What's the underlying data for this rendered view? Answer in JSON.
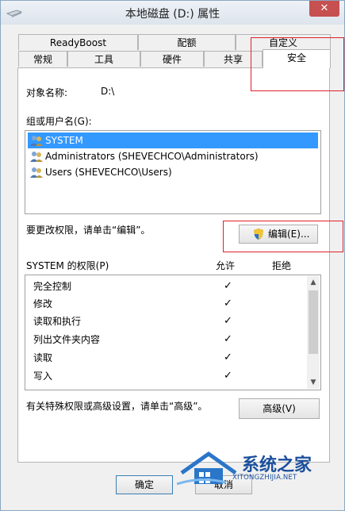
{
  "window": {
    "title": "本地磁盘 (D:) 属性",
    "close_label": "✕"
  },
  "tabs_row1": [
    "ReadyBoost",
    "配额",
    "自定义"
  ],
  "tabs_row2": [
    "常规",
    "工具",
    "硬件",
    "共享",
    "安全"
  ],
  "active_tab": "安全",
  "object": {
    "label": "对象名称:",
    "value": "D:\\"
  },
  "groups": {
    "label": "组或用户名(G):",
    "items": [
      {
        "name": "SYSTEM",
        "selected": true
      },
      {
        "name": "Administrators (SHEVECHCO\\Administrators)",
        "selected": false
      },
      {
        "name": "Users (SHEVECHCO\\Users)",
        "selected": false
      }
    ]
  },
  "change_hint": "要更改权限，请单击“编辑”。",
  "edit_button": "编辑(E)...",
  "permissions": {
    "title": "SYSTEM 的权限(P)",
    "allow_header": "允许",
    "deny_header": "拒绝",
    "rows": [
      {
        "name": "完全控制",
        "allow": "✓"
      },
      {
        "name": "修改",
        "allow": "✓"
      },
      {
        "name": "读取和执行",
        "allow": "✓"
      },
      {
        "name": "列出文件夹内容",
        "allow": "✓"
      },
      {
        "name": "读取",
        "allow": "✓"
      },
      {
        "name": "写入",
        "allow": "✓"
      }
    ]
  },
  "advanced_hint": "有关特殊权限或高级设置，请单击“高级”。",
  "advanced_button": "高级(V)",
  "ok_button": "确定",
  "cancel_button": "取消",
  "watermark": {
    "text": "系统之家",
    "sub": "XITONGZHIJIA.NET"
  }
}
